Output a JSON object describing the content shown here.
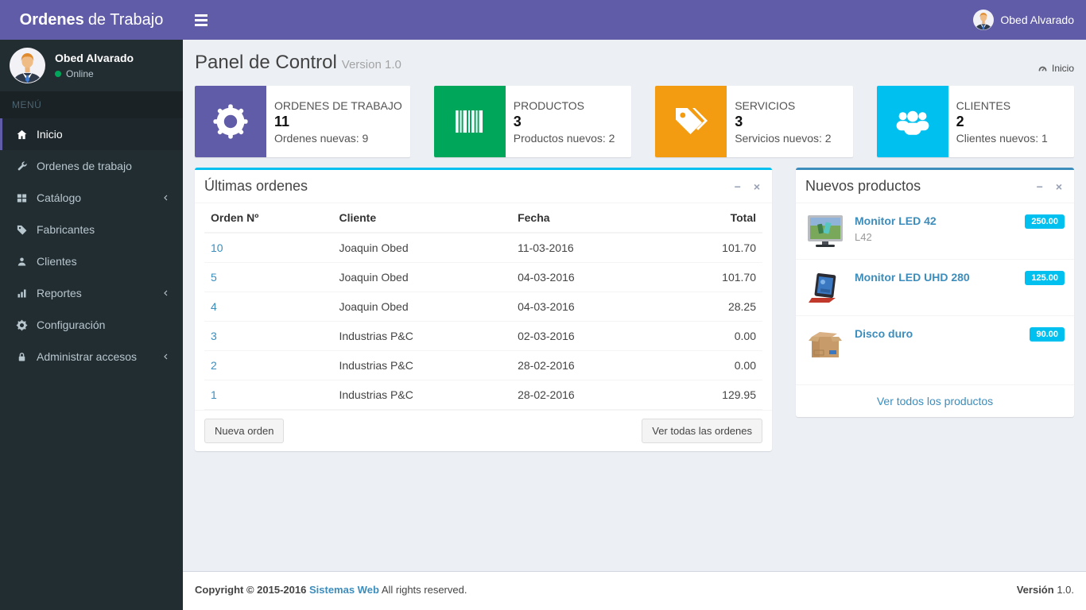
{
  "header": {
    "brand_bold": "Ordenes",
    "brand_rest": "de Trabajo",
    "user_name": "Obed Alvarado"
  },
  "sidebar": {
    "user": {
      "name": "Obed Alvarado",
      "status": "Online"
    },
    "menu_header": "MENÚ",
    "items": [
      {
        "label": "Inicio",
        "icon": "home",
        "active": true,
        "arrow": false
      },
      {
        "label": "Ordenes de trabajo",
        "icon": "wrench",
        "active": false,
        "arrow": false
      },
      {
        "label": "Catálogo",
        "icon": "grid",
        "active": false,
        "arrow": true
      },
      {
        "label": "Fabricantes",
        "icon": "tag",
        "active": false,
        "arrow": false
      },
      {
        "label": "Clientes",
        "icon": "user",
        "active": false,
        "arrow": false
      },
      {
        "label": "Reportes",
        "icon": "chart",
        "active": false,
        "arrow": true
      },
      {
        "label": "Configuración",
        "icon": "gear",
        "active": false,
        "arrow": false
      },
      {
        "label": "Administrar accesos",
        "icon": "lock",
        "active": false,
        "arrow": true
      }
    ]
  },
  "content_header": {
    "title": "Panel de Control",
    "subtitle": "Version 1.0",
    "breadcrumb": "Inicio"
  },
  "info_boxes": [
    {
      "label": "ORDENES DE TRABAJO",
      "value": "11",
      "description": "Ordenes nuevas: 9",
      "color": "#605ca8",
      "icon": "gear"
    },
    {
      "label": "PRODUCTOS",
      "value": "3",
      "description": "Productos nuevos: 2",
      "color": "#00a65a",
      "icon": "barcode"
    },
    {
      "label": "SERVICIOS",
      "value": "3",
      "description": "Servicios nuevos: 2",
      "color": "#f39c12",
      "icon": "tags"
    },
    {
      "label": "CLIENTES",
      "value": "2",
      "description": "Clientes nuevos: 1",
      "color": "#00c0ef",
      "icon": "users"
    }
  ],
  "orders_panel": {
    "title": "Últimas ordenes",
    "columns": [
      "Orden Nº",
      "Cliente",
      "Fecha",
      "Total"
    ],
    "rows": [
      {
        "order": "10",
        "client": "Joaquin Obed",
        "date": "11-03-2016",
        "total": "101.70"
      },
      {
        "order": "5",
        "client": "Joaquin Obed",
        "date": "04-03-2016",
        "total": "101.70"
      },
      {
        "order": "4",
        "client": "Joaquin Obed",
        "date": "04-03-2016",
        "total": "28.25"
      },
      {
        "order": "3",
        "client": "Industrias P&C",
        "date": "02-03-2016",
        "total": "0.00"
      },
      {
        "order": "2",
        "client": "Industrias P&C",
        "date": "28-02-2016",
        "total": "0.00"
      },
      {
        "order": "1",
        "client": "Industrias P&C",
        "date": "28-02-2016",
        "total": "129.95"
      }
    ],
    "new_order_button": "Nueva orden",
    "view_all_button": "Ver todas las ordenes"
  },
  "products_panel": {
    "title": "Nuevos productos",
    "items": [
      {
        "name": "Monitor LED 42",
        "subtitle": "L42",
        "price": "250.00",
        "image": "monitor-landscape"
      },
      {
        "name": "Monitor LED UHD 280",
        "subtitle": "",
        "price": "125.00",
        "image": "convertible-red"
      },
      {
        "name": "Disco duro",
        "subtitle": "",
        "price": "90.00",
        "image": "cardboard-box"
      }
    ],
    "view_all_link": "Ver todos los productos",
    "badge_color": "#00c0ef"
  },
  "footer": {
    "copyright": "Copyright © 2015-2016",
    "company": "Sistemas Web",
    "rights": "All rights reserved.",
    "version_label": "Versión",
    "version_value": "1.0."
  }
}
